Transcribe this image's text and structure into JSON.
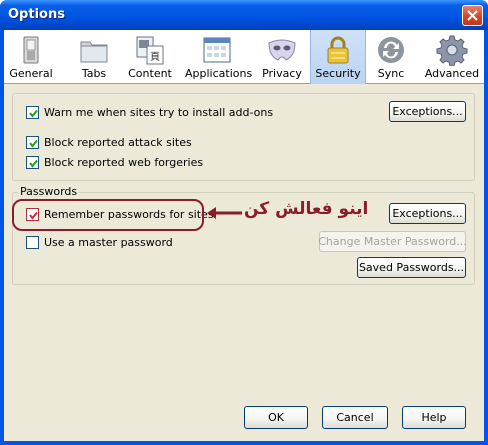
{
  "window": {
    "title": "Options"
  },
  "tabs": [
    {
      "label": "General",
      "icon": "switch-icon"
    },
    {
      "label": "Tabs",
      "icon": "tabs-folder-icon"
    },
    {
      "label": "Content",
      "icon": "content-icon"
    },
    {
      "label": "Applications",
      "icon": "applications-icon"
    },
    {
      "label": "Privacy",
      "icon": "mask-icon"
    },
    {
      "label": "Security",
      "icon": "padlock-icon",
      "selected": true
    },
    {
      "label": "Sync",
      "icon": "sync-icon"
    },
    {
      "label": "Advanced",
      "icon": "gear-icon"
    }
  ],
  "security": {
    "warn_addons": {
      "label": "Warn me when sites try to install add-ons",
      "checked": true
    },
    "addon_exceptions_label": "Exceptions...",
    "block_attack": {
      "label": "Block reported attack sites",
      "checked": true
    },
    "block_forgery": {
      "label": "Block reported web forgeries",
      "checked": true
    }
  },
  "passwords": {
    "legend": "Passwords",
    "remember": {
      "label": "Remember passwords for sites",
      "checked": true
    },
    "exceptions_label": "Exceptions...",
    "master": {
      "label": "Use a master password",
      "checked": false
    },
    "change_master_label": "Change Master Password...",
    "saved_passwords_label": "Saved Passwords..."
  },
  "annotation": {
    "text": "اینو فعالش کن",
    "color": "#8a1c2c"
  },
  "footer": {
    "ok_label": "OK",
    "cancel_label": "Cancel",
    "help_label": "Help"
  },
  "colors": {
    "titlebar": "#0054e3",
    "dialog_bg": "#ece9d8",
    "selected_tab": "#c4daf5",
    "annotation": "#8a1c2c"
  }
}
